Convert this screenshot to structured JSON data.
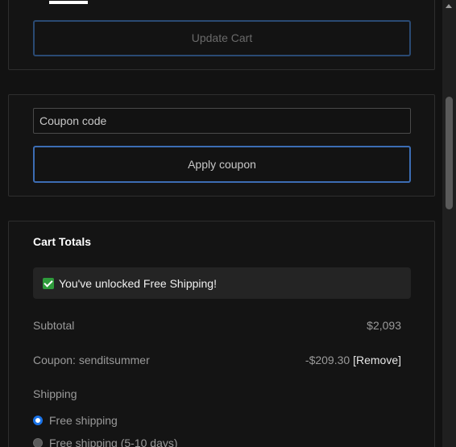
{
  "cart_actions": {
    "update_cart_label": "Update Cart"
  },
  "coupon": {
    "input_placeholder": "Coupon code",
    "input_value": "",
    "apply_label": "Apply coupon"
  },
  "cart_totals": {
    "title": "Cart Totals",
    "notice_text": "You've unlocked Free Shipping!",
    "subtotal_label": "Subtotal",
    "subtotal_value": "$2,093",
    "coupon_label": "Coupon: senditsummer",
    "coupon_value": "-$209.30",
    "remove_label": "[Remove]",
    "shipping_label": "Shipping",
    "shipping_options": [
      {
        "label": "Free shipping",
        "selected": true
      },
      {
        "label": "Free shipping (5-10 days)",
        "selected": false
      }
    ]
  },
  "colors": {
    "background": "#121212",
    "accent": "#3c6db4",
    "success": "#2e9b3b"
  }
}
